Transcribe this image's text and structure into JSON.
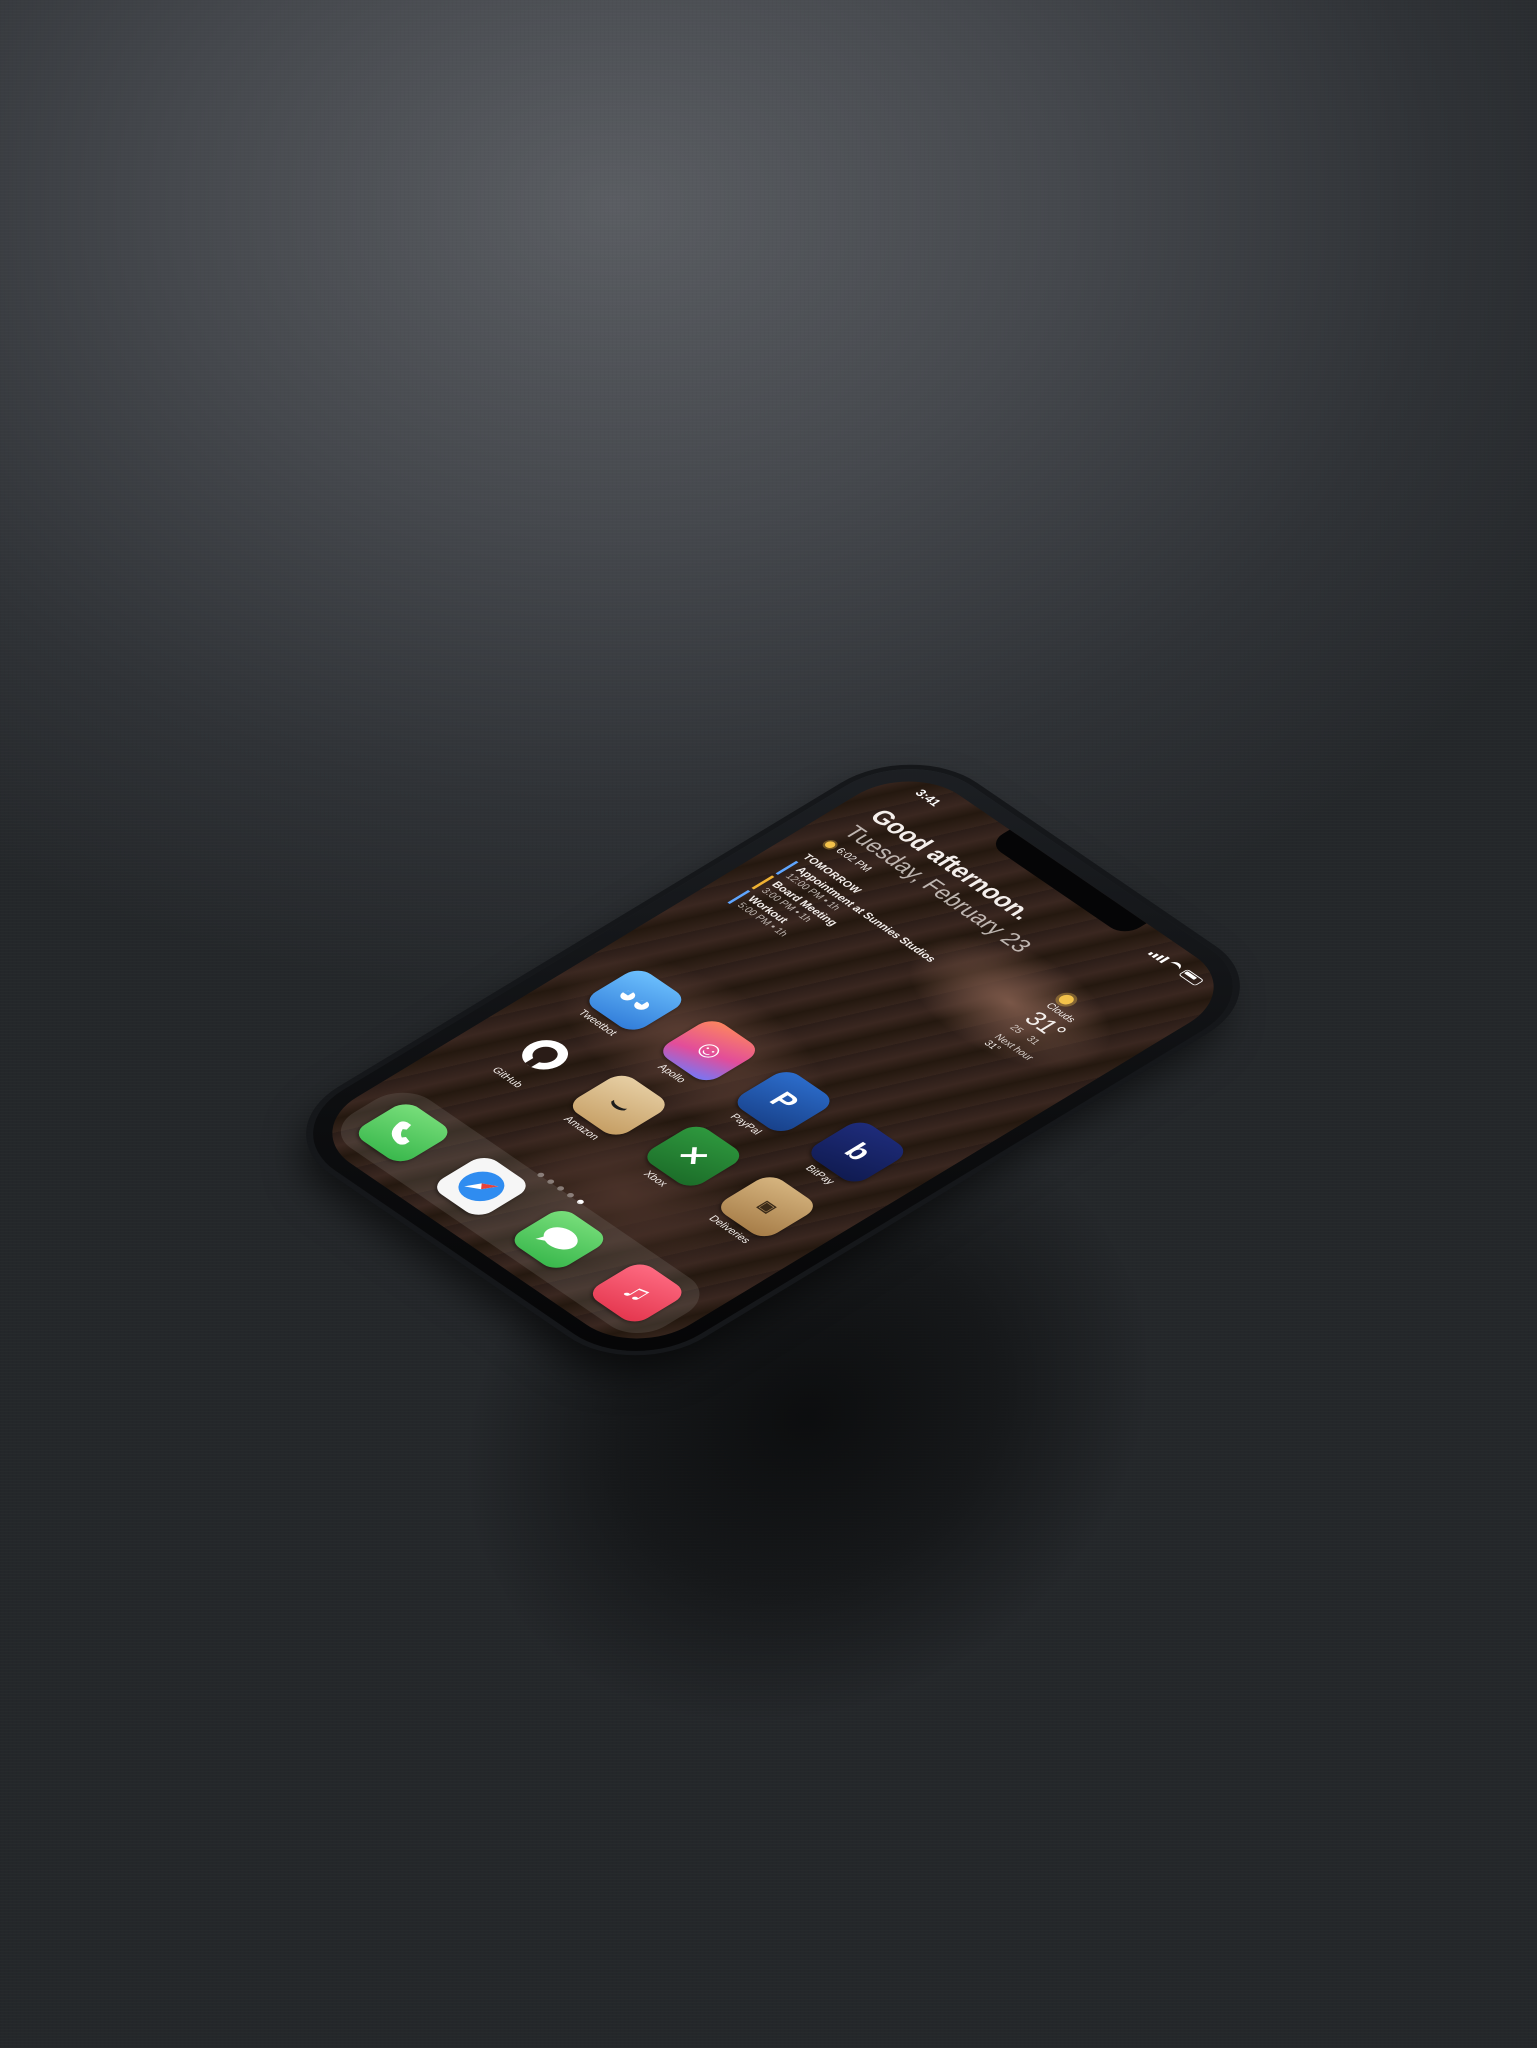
{
  "status_bar": {
    "time": "3:41"
  },
  "greeting_widget": {
    "greeting": "Good afternoon.",
    "date": "Tuesday, February 23",
    "sunset": "6:02 PM"
  },
  "calendar_widget": {
    "heading": "TOMORROW",
    "events": [
      {
        "title": "Appointment at Sunnies Studios",
        "time": "12:00 PM • 1h"
      },
      {
        "title": "Board Meeting",
        "time": "3:00 PM • 1h"
      },
      {
        "title": "Workout",
        "time": "5:00 PM • 1h"
      }
    ]
  },
  "weather_widget": {
    "condition": "Clouds",
    "temperature": "31°",
    "low": "25",
    "high": "31",
    "next_hour_label": "Next hour",
    "next_hour_temp": "31°"
  },
  "apps": [
    {
      "label": "Tweetbot",
      "icon": "tweetbot-icon"
    },
    {
      "label": "Apollo",
      "icon": "apollo-icon"
    },
    {
      "label": "PayPal",
      "icon": "paypal-icon"
    },
    {
      "label": "BitPay",
      "icon": "bitpay-icon"
    },
    {
      "label": "GitHub",
      "icon": "github-icon"
    },
    {
      "label": "Amazon",
      "icon": "amazon-icon"
    },
    {
      "label": "Xbox",
      "icon": "xbox-icon"
    },
    {
      "label": "Deliveries",
      "icon": "deliveries-icon"
    }
  ],
  "page_indicator": {
    "pages": 5,
    "current": 5
  },
  "dock": [
    {
      "icon": "phone-icon"
    },
    {
      "icon": "safari-icon"
    },
    {
      "icon": "messages-icon"
    },
    {
      "icon": "music-icon"
    }
  ],
  "colors": {
    "background": "#3b3e42",
    "phone_body": "#0c0d0f",
    "wallpaper": "#2a1c17",
    "accent_blue": "#5fa6ff",
    "accent_yellow": "#f0b233"
  }
}
